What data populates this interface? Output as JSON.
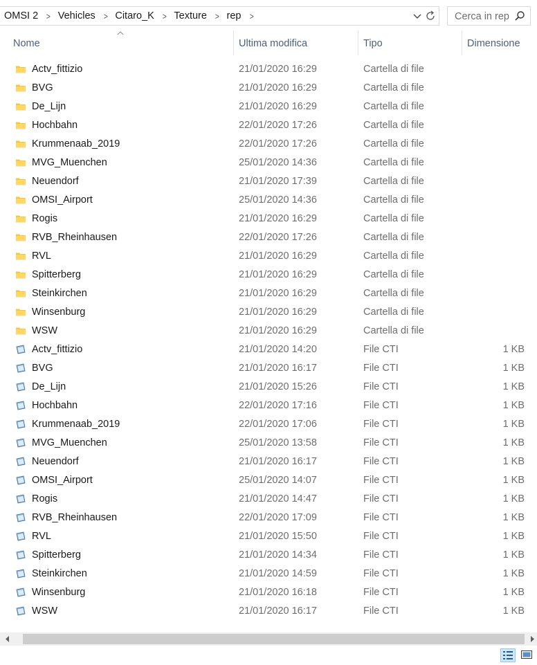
{
  "breadcrumb": [
    "OMSI 2",
    "Vehicles",
    "Citaro_K",
    "Texture",
    "rep"
  ],
  "search": {
    "placeholder": "Cerca in rep"
  },
  "columns": {
    "name": "Nome",
    "modified": "Ultima modifica",
    "type": "Tipo",
    "size": "Dimensione"
  },
  "icons": {
    "folder": "folder-icon",
    "file": "cti-file-icon",
    "search": "search-icon",
    "refresh": "refresh-icon",
    "chevron": "chevron-down-icon",
    "details_view": "details-view-icon",
    "large_icons_view": "large-icons-view-icon"
  },
  "colors": {
    "folder": "#f4c44e",
    "accent": "#cce8ff",
    "header_text": "#4c607a",
    "muted_text": "#6d6d6d"
  },
  "files": [
    {
      "name": "Actv_fittizio",
      "date": "21/01/2020 16:29",
      "type": "Cartella di file",
      "size": "",
      "kind": "folder"
    },
    {
      "name": "BVG",
      "date": "21/01/2020 16:29",
      "type": "Cartella di file",
      "size": "",
      "kind": "folder"
    },
    {
      "name": "De_Lijn",
      "date": "21/01/2020 16:29",
      "type": "Cartella di file",
      "size": "",
      "kind": "folder"
    },
    {
      "name": "Hochbahn",
      "date": "22/01/2020 17:26",
      "type": "Cartella di file",
      "size": "",
      "kind": "folder"
    },
    {
      "name": "Krummenaab_2019",
      "date": "22/01/2020 17:26",
      "type": "Cartella di file",
      "size": "",
      "kind": "folder"
    },
    {
      "name": "MVG_Muenchen",
      "date": "25/01/2020 14:36",
      "type": "Cartella di file",
      "size": "",
      "kind": "folder"
    },
    {
      "name": "Neuendorf",
      "date": "21/01/2020 17:39",
      "type": "Cartella di file",
      "size": "",
      "kind": "folder"
    },
    {
      "name": "OMSI_Airport",
      "date": "25/01/2020 14:36",
      "type": "Cartella di file",
      "size": "",
      "kind": "folder"
    },
    {
      "name": "Rogis",
      "date": "21/01/2020 16:29",
      "type": "Cartella di file",
      "size": "",
      "kind": "folder"
    },
    {
      "name": "RVB_Rheinhausen",
      "date": "22/01/2020 17:26",
      "type": "Cartella di file",
      "size": "",
      "kind": "folder"
    },
    {
      "name": "RVL",
      "date": "21/01/2020 16:29",
      "type": "Cartella di file",
      "size": "",
      "kind": "folder"
    },
    {
      "name": "Spitterberg",
      "date": "21/01/2020 16:29",
      "type": "Cartella di file",
      "size": "",
      "kind": "folder"
    },
    {
      "name": "Steinkirchen",
      "date": "21/01/2020 16:29",
      "type": "Cartella di file",
      "size": "",
      "kind": "folder"
    },
    {
      "name": "Winsenburg",
      "date": "21/01/2020 16:29",
      "type": "Cartella di file",
      "size": "",
      "kind": "folder"
    },
    {
      "name": "WSW",
      "date": "21/01/2020 16:29",
      "type": "Cartella di file",
      "size": "",
      "kind": "folder"
    },
    {
      "name": "Actv_fittizio",
      "date": "21/01/2020 14:20",
      "type": "File CTI",
      "size": "1 KB",
      "kind": "file"
    },
    {
      "name": "BVG",
      "date": "21/01/2020 16:17",
      "type": "File CTI",
      "size": "1 KB",
      "kind": "file"
    },
    {
      "name": "De_Lijn",
      "date": "21/01/2020 15:26",
      "type": "File CTI",
      "size": "1 KB",
      "kind": "file"
    },
    {
      "name": "Hochbahn",
      "date": "22/01/2020 17:16",
      "type": "File CTI",
      "size": "1 KB",
      "kind": "file"
    },
    {
      "name": "Krummenaab_2019",
      "date": "22/01/2020 17:06",
      "type": "File CTI",
      "size": "1 KB",
      "kind": "file"
    },
    {
      "name": "MVG_Muenchen",
      "date": "25/01/2020 13:58",
      "type": "File CTI",
      "size": "1 KB",
      "kind": "file"
    },
    {
      "name": "Neuendorf",
      "date": "21/01/2020 16:17",
      "type": "File CTI",
      "size": "1 KB",
      "kind": "file"
    },
    {
      "name": "OMSI_Airport",
      "date": "25/01/2020 14:07",
      "type": "File CTI",
      "size": "1 KB",
      "kind": "file"
    },
    {
      "name": "Rogis",
      "date": "21/01/2020 14:47",
      "type": "File CTI",
      "size": "1 KB",
      "kind": "file"
    },
    {
      "name": "RVB_Rheinhausen",
      "date": "22/01/2020 17:09",
      "type": "File CTI",
      "size": "1 KB",
      "kind": "file"
    },
    {
      "name": "RVL",
      "date": "21/01/2020 15:50",
      "type": "File CTI",
      "size": "1 KB",
      "kind": "file"
    },
    {
      "name": "Spitterberg",
      "date": "21/01/2020 14:34",
      "type": "File CTI",
      "size": "1 KB",
      "kind": "file"
    },
    {
      "name": "Steinkirchen",
      "date": "21/01/2020 14:59",
      "type": "File CTI",
      "size": "1 KB",
      "kind": "file"
    },
    {
      "name": "Winsenburg",
      "date": "21/01/2020 16:18",
      "type": "File CTI",
      "size": "1 KB",
      "kind": "file"
    },
    {
      "name": "WSW",
      "date": "21/01/2020 16:17",
      "type": "File CTI",
      "size": "1 KB",
      "kind": "file"
    }
  ]
}
